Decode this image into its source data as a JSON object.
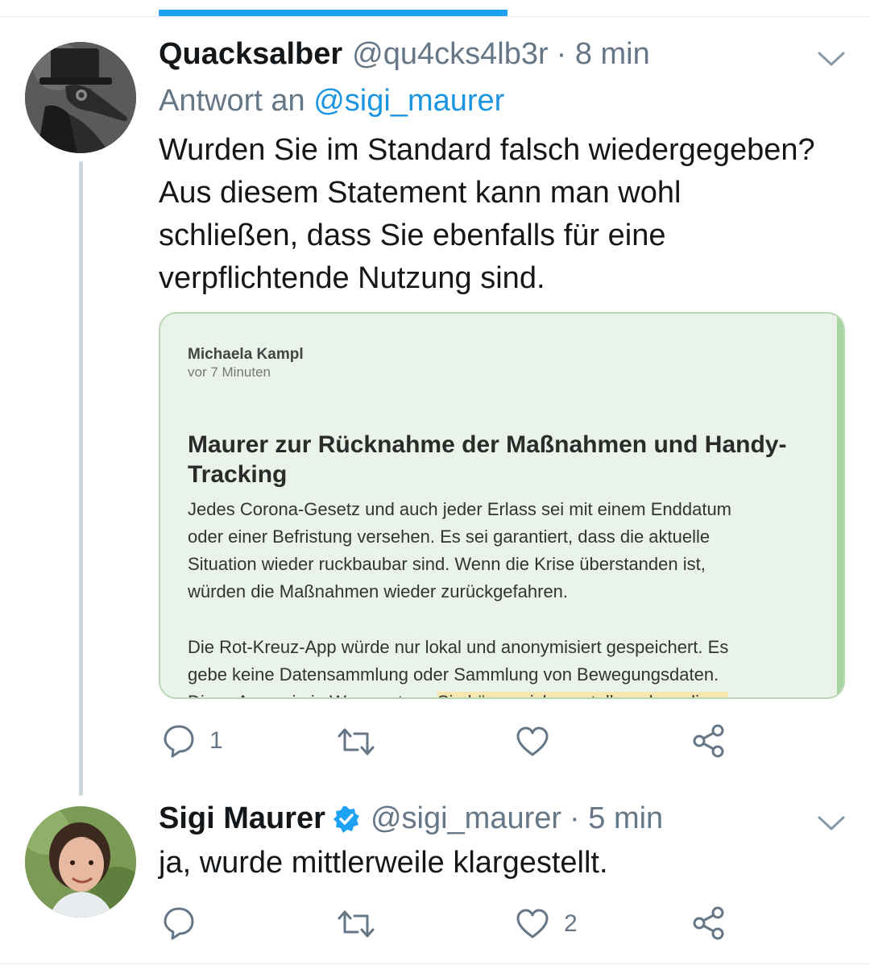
{
  "tweet1": {
    "name": "Quacksalber",
    "handle": "@qu4cks4lb3r",
    "time": "· 8 min",
    "reply_prefix": "Antwort an",
    "reply_handle": "@sigi_maurer",
    "text_lines": [
      "Wurden Sie im Standard falsch wiedergegeben?",
      "Aus diesem Statement kann man wohl",
      "schließen, dass Sie ebenfalls für eine",
      "verpflichtende Nutzung sind."
    ],
    "card": {
      "author": "Michaela Kampl",
      "time": "vor 7 Minuten",
      "title_lines": [
        "Maurer zur Rücknahme der Maßnahmen und Handy-",
        "Tracking"
      ],
      "paragraph1_lines": [
        "Jedes Corona-Gesetz und auch jeder Erlass sei mit einem Enddatum",
        "oder einer Befristung versehen. Es sei garantiert, dass die aktuelle",
        "Situation wieder ruckbaubar sind. Wenn die Krise überstanden ist,",
        "würden die Maßnahmen wieder zurückgefahren."
      ],
      "paragraph2_lines": [
        "Die Rot-Kreuz-App würde nur lokal und anonymisiert gespeichert. Es",
        "gebe keine Datensammlung oder Sammlung von Bewegungsdaten.",
        "Diese App sei ein Warnsystem."
      ],
      "paragraph2_highlight": "Sie könne sich vorstellen, dass diese"
    },
    "actions": {
      "reply_count": "1",
      "retweet_count": "",
      "like_count": ""
    }
  },
  "tweet2": {
    "name": "Sigi Maurer",
    "handle": "@sigi_maurer",
    "time": "· 5 min",
    "text": "ja, wurde mittlerweile klargestellt.",
    "actions": {
      "reply_count": "",
      "retweet_count": "",
      "like_count": "2"
    }
  },
  "colors": {
    "accent": "#1da1f2",
    "verified": "#1da1f2",
    "muted": "#657786",
    "card_bg": "#e9f3e9"
  }
}
